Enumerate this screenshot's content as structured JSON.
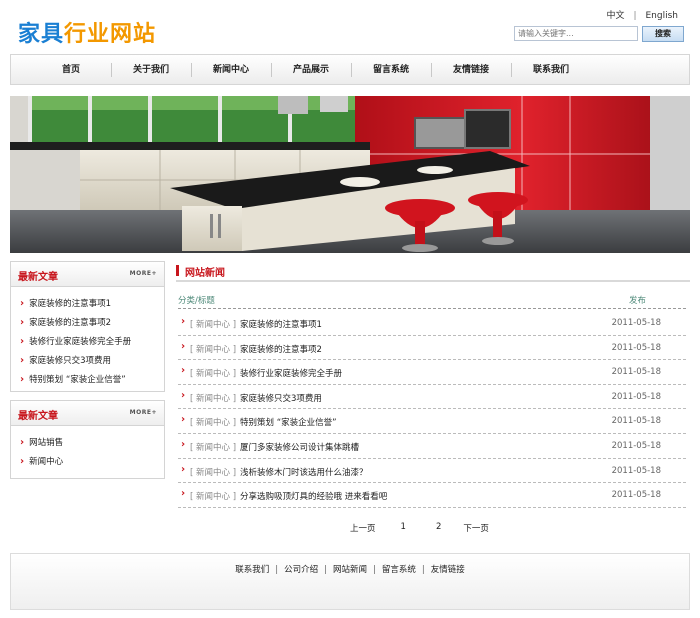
{
  "header": {
    "logo_part1": "家具",
    "logo_part2": "行业网站",
    "lang_cn": "中文",
    "lang_sep": "|",
    "lang_en": "English",
    "search_placeholder": "请输入关键字...",
    "search_button": "搜索"
  },
  "nav": [
    "首页",
    "关于我们",
    "新闻中心",
    "产品展示",
    "留言系统",
    "友情链接",
    "联系我们"
  ],
  "sidebar": [
    {
      "title": "最新文章",
      "more": "MORE+",
      "items": [
        "家庭装修的注意事项1",
        "家庭装修的注意事项2",
        "装修行业家庭装修完全手册",
        "家庭装修只交3项费用",
        "特别策划 “家装企业信誉”"
      ]
    },
    {
      "title": "最新文章",
      "more": "MORE+",
      "items": [
        "网站销售",
        "新闻中心"
      ]
    }
  ],
  "news": {
    "title": "网站新闻",
    "col_category": "分类/标题",
    "col_date": "发布",
    "rows": [
      {
        "category": "[ 新闻中心 ]",
        "title": "家庭装修的注意事项1",
        "date": "2011-05-18"
      },
      {
        "category": "[ 新闻中心 ]",
        "title": "家庭装修的注意事项2",
        "date": "2011-05-18"
      },
      {
        "category": "[ 新闻中心 ]",
        "title": "装修行业家庭装修完全手册",
        "date": "2011-05-18"
      },
      {
        "category": "[ 新闻中心 ]",
        "title": "家庭装修只交3项费用",
        "date": "2011-05-18"
      },
      {
        "category": "[ 新闻中心 ]",
        "title": "特别策划 “家装企业信誉”",
        "date": "2011-05-18"
      },
      {
        "category": "[ 新闻中心 ]",
        "title": "厦门多家装修公司设计集体跳槽",
        "date": "2011-05-18"
      },
      {
        "category": "[ 新闻中心 ]",
        "title": "浅析装修木门时该选用什么油漆？",
        "date": "2011-05-18"
      },
      {
        "category": "[ 新闻中心 ]",
        "title": "分享选购吸顶灯具的经验哦 进来看看吧",
        "date": "2011-05-18"
      }
    ]
  },
  "pager": {
    "prev": "上一页",
    "p1": "1",
    "p2": "2",
    "next": "下一页"
  },
  "footer": {
    "links": [
      "联系我们",
      "公司介绍",
      "网站新闻",
      "留言系统",
      "友情链接"
    ],
    "sep": "|"
  },
  "colors": {
    "accent_red": "#c8161d",
    "logo_blue": "#1a7fd3",
    "logo_orange": "#f39800"
  }
}
